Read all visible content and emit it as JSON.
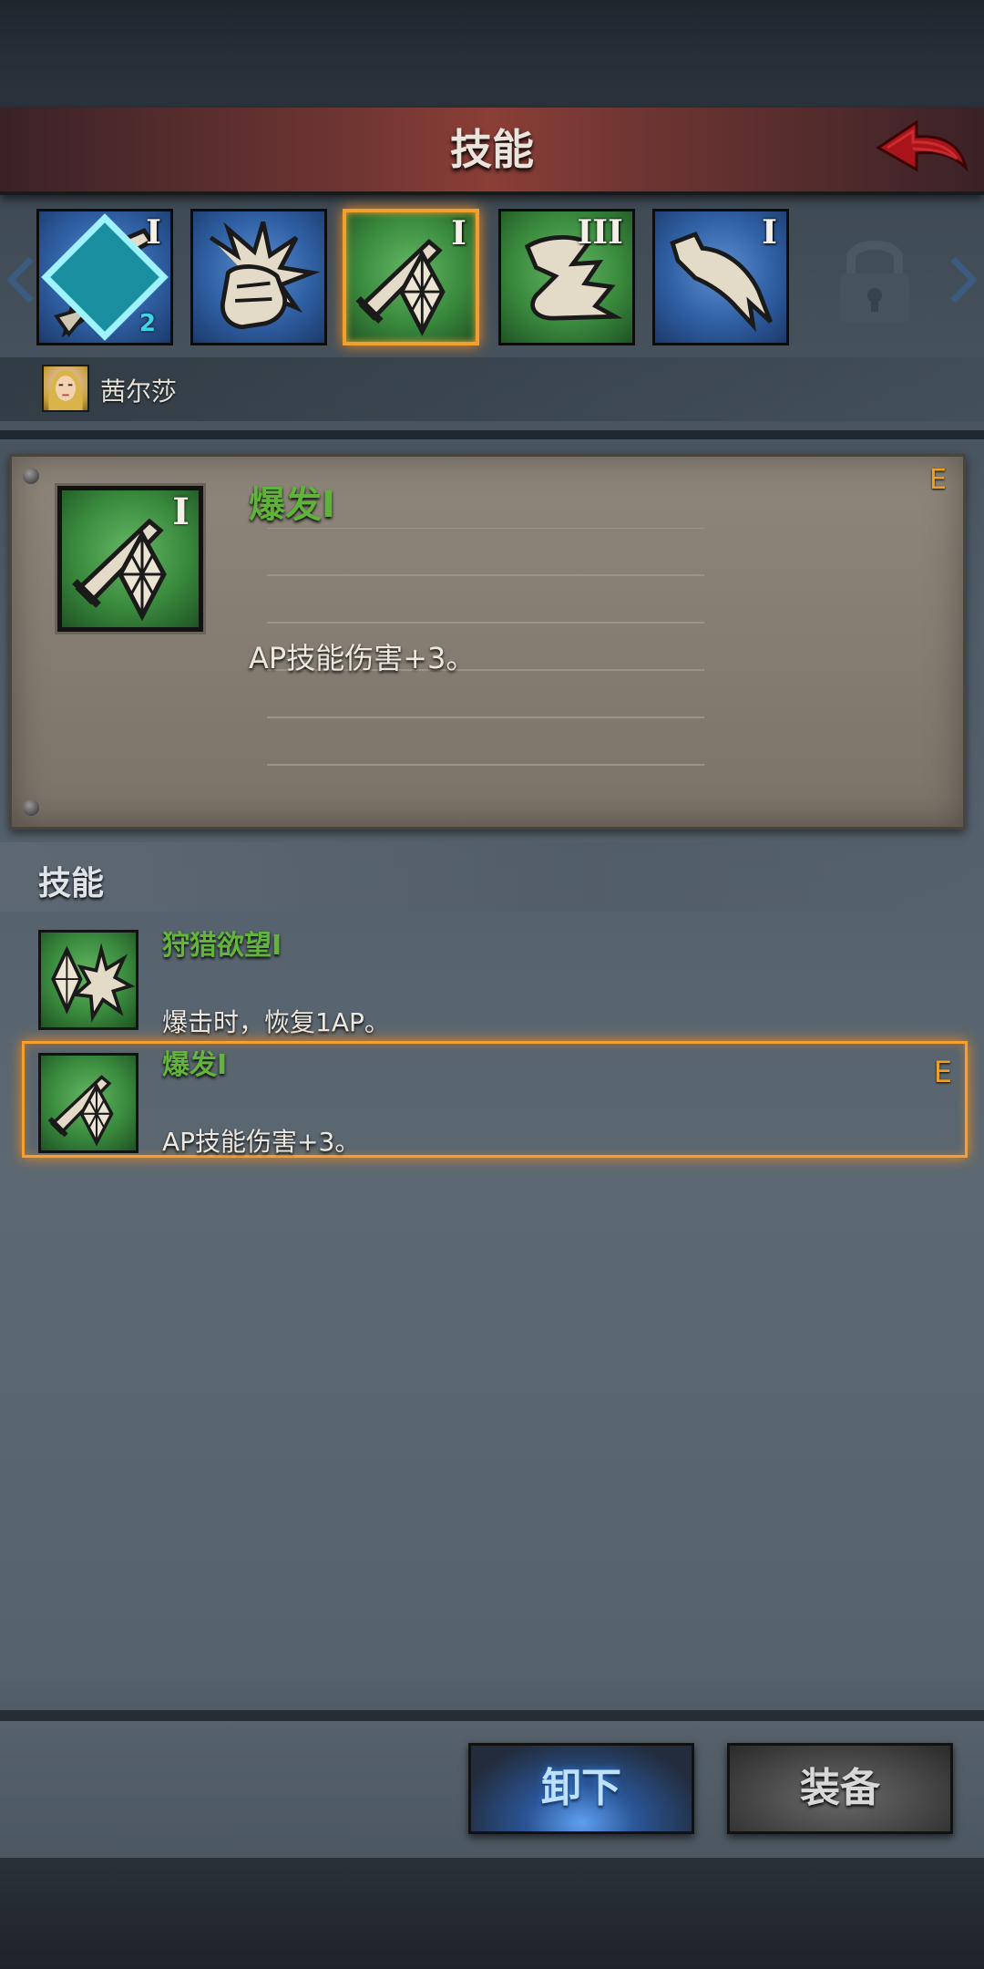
{
  "header": {
    "title": "技能",
    "back_icon": "back-arrow-icon"
  },
  "skill_tabs": [
    {
      "icon": "sword-slash-icon",
      "rank": "I",
      "badge_count": "2",
      "color": "blue",
      "selected": false
    },
    {
      "icon": "fist-impact-icon",
      "rank": "",
      "color": "blue",
      "selected": false
    },
    {
      "icon": "sword-crystal-icon",
      "rank": "I",
      "color": "green",
      "selected": true
    },
    {
      "icon": "claw-boot-icon",
      "rank": "III",
      "color": "green",
      "selected": false
    },
    {
      "icon": "talon-icon",
      "rank": "I",
      "color": "blue",
      "selected": false
    }
  ],
  "locked_slot_icon": "padlock-icon",
  "character": {
    "name": "茜尔莎"
  },
  "detail": {
    "name": "爆发I",
    "rank": "I",
    "description": "AP技能伤害+3。",
    "equipped_mark": "E",
    "icon": "sword-crystal-icon"
  },
  "skill_list": {
    "title": "技能",
    "items": [
      {
        "name": "狩猎欲望I",
        "description": "爆击时，恢复1AP。",
        "equipped_mark": "",
        "icon": "crystal-burst-icon",
        "selected": false
      },
      {
        "name": "爆发I",
        "description": "AP技能伤害+3。",
        "equipped_mark": "E",
        "icon": "sword-crystal-icon",
        "selected": true
      }
    ]
  },
  "buttons": {
    "unequip_label": "卸下",
    "equip_label": "装备"
  },
  "colors": {
    "skill_name": "#63b43c",
    "equipped_mark": "#f0a020",
    "selected_border": "#f5a030",
    "title_bar": "#8a3e36"
  }
}
